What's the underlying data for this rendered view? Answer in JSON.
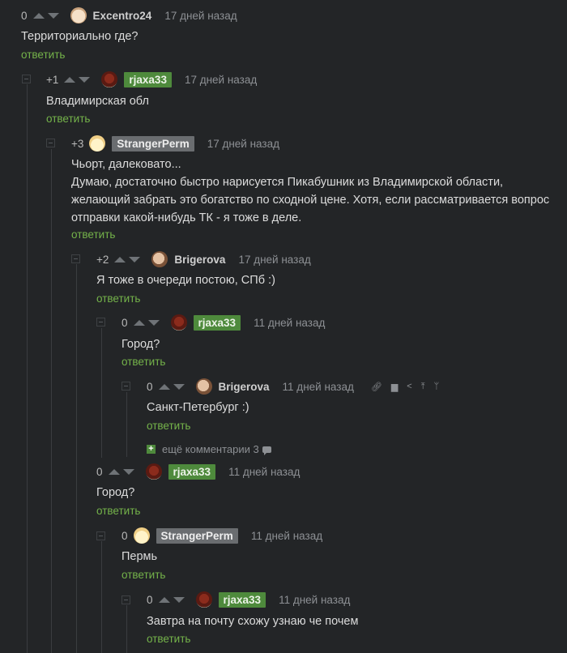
{
  "reply_label": "ответить",
  "comments": [
    {
      "rating": "0",
      "user": "Excentro24",
      "time": "17 дней назад",
      "text": [
        "Территориально где?"
      ]
    },
    {
      "rating": "+1",
      "user": "rjaxa33",
      "time": "17 дней назад",
      "text": [
        "Владимирская обл"
      ]
    },
    {
      "rating": "+3",
      "user": "StrangerPerm",
      "time": "17 дней назад",
      "text": [
        "Чьорт, далековато...",
        "Думаю, достаточно быстро нарисуется Пикабушник из Владимирской области,",
        "желающий забрать это богатство по сходной цене. Хотя, если рассматривается вопрос",
        "отправки какой-нибудь ТК - я тоже в деле."
      ]
    },
    {
      "rating": "+2",
      "user": "Brigerova",
      "time": "17 дней назад",
      "text": [
        "Я тоже в очереди постою, СПб :)"
      ]
    },
    {
      "rating": "0",
      "user": "rjaxa33",
      "time": "11 дней назад",
      "text": [
        "Город?"
      ]
    },
    {
      "rating": "0",
      "user": "Brigerova",
      "time": "11 дней назад",
      "text": [
        "Санкт-Петербург :)"
      ]
    },
    {
      "rating": "0",
      "user": "rjaxa33",
      "time": "11 дней назад",
      "text": [
        "Город?"
      ]
    },
    {
      "rating": "0",
      "user": "StrangerPerm",
      "time": "11 дней назад",
      "text": [
        "Пермь"
      ]
    },
    {
      "rating": "0",
      "user": "rjaxa33",
      "time": "11 дней назад",
      "text": [
        "Завтра на почту схожу узнаю че почем"
      ]
    }
  ],
  "more_comments": {
    "label": "ещё комментарии 3"
  },
  "colors": {
    "background": "#232527",
    "reply_link": "#74b34a",
    "badge_green": "#4e8a3c",
    "badge_gray": "#6a6d70"
  },
  "icons": [
    "link-icon",
    "save-icon",
    "share-icon",
    "pin-icon",
    "branch-icon"
  ]
}
